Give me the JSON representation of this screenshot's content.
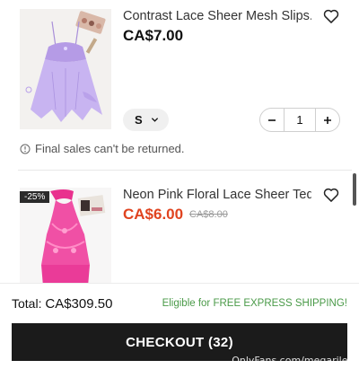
{
  "items": [
    {
      "title": "Contrast Lace Sheer Mesh Slips...",
      "price": "CA$7.00",
      "size": "S",
      "quantity": "1",
      "notice": "Final sales can't be returned."
    },
    {
      "badge": "-25%",
      "title": "Neon Pink Floral Lace Sheer Ted...",
      "sale_price": "CA$6.00",
      "original_price": "CA$8.00"
    }
  ],
  "footer": {
    "total_label": "Total:",
    "total_amount": "CA$309.50",
    "shipping_text": "Eligible for FREE EXPRESS SHIPPING!",
    "checkout_label": "CHECKOUT (32)"
  },
  "watermark": "OnlyFans.com/megariley",
  "colors": {
    "sale_price": "#e0431f",
    "shipping_green": "#4a9a48",
    "checkout_bg": "#1b1b1b"
  },
  "icons": [
    "heart-outline-icon",
    "chevron-down-icon",
    "minus-icon",
    "plus-icon",
    "info-circle-icon"
  ]
}
